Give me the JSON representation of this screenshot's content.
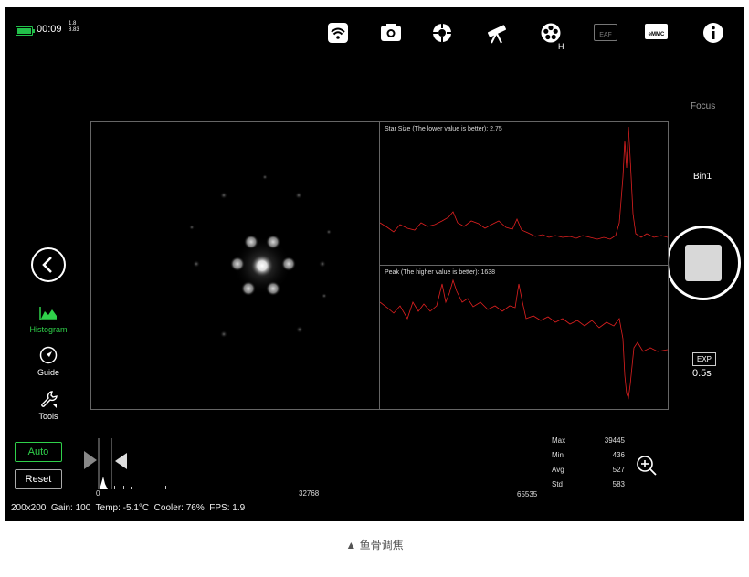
{
  "status": {
    "time": "00:09",
    "value_top": "1.8",
    "value_bottom": "8.83",
    "battery_color": "#22c04a"
  },
  "toolbar": {
    "icons": [
      "wifi-icon",
      "camera-icon",
      "target-icon",
      "telescope-icon",
      "filter-wheel-icon",
      "eaf-icon",
      "emmc-icon",
      "info-icon"
    ],
    "filter_wheel_label": "H",
    "eaf_label": "EAF",
    "emmc_label": "eMMC"
  },
  "right_panel": {
    "mode_label": "Focus",
    "bin_label": "Bin1",
    "exp_button": "EXP",
    "exp_value": "0.5s"
  },
  "left_panel": {
    "histogram_label": "Histogram",
    "guide_label": "Guide",
    "tools_label": "Tools",
    "accent_color": "#2fd14a"
  },
  "graphs": {
    "star_size_label": "Star Size (The lower value is better): 2.75",
    "peak_label": "Peak (The higher value is better): 1638",
    "line_color": "#e02020"
  },
  "histogram": {
    "auto_button": "Auto",
    "reset_button": "Reset",
    "scale_min": "0",
    "scale_mid": "32768",
    "scale_max": "65535"
  },
  "stats": {
    "rows": [
      {
        "label": "Max",
        "value": "39445"
      },
      {
        "label": "Min",
        "value": "436"
      },
      {
        "label": "Avg",
        "value": "527"
      },
      {
        "label": "Std",
        "value": "583"
      }
    ]
  },
  "bottom_status": "200x200  Gain: 100  Temp: -5.1°C  Cooler: 76%  FPS: 1.9",
  "caption": "▲ 鱼骨调焦"
}
